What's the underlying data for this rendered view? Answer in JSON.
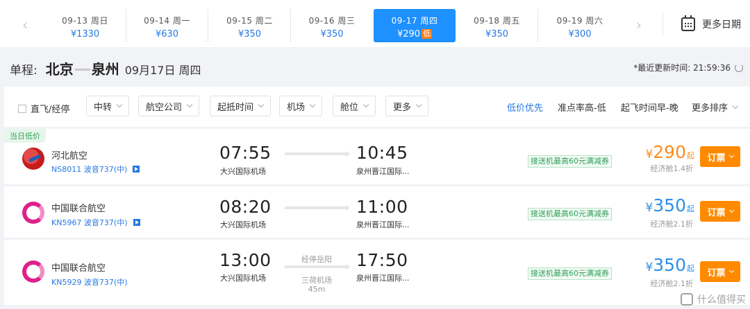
{
  "date_bar": {
    "prev_label": "‹",
    "next_label": "›",
    "dates": [
      {
        "day": "09-13  周日",
        "price": "¥1330"
      },
      {
        "day": "09-14  周一",
        "price": "¥630"
      },
      {
        "day": "09-15  周二",
        "price": "¥350"
      },
      {
        "day": "09-16  周三",
        "price": "¥350"
      },
      {
        "day": "09-17  周四",
        "price": "¥290",
        "tag": "低"
      },
      {
        "day": "09-18  周五",
        "price": "¥350"
      },
      {
        "day": "09-19  周六",
        "price": "¥300"
      }
    ],
    "more_dates": "更多日期"
  },
  "route": {
    "label": "单程:",
    "from": "北京",
    "to": "泉州",
    "date": "09月17日 周四",
    "update_text": "*最近更新时间: 21:59:36"
  },
  "filters": {
    "direct": "直飞/经停",
    "transfer": "中转",
    "airline": "航空公司",
    "time": "起抵时间",
    "airport": "机场",
    "cabin": "舱位",
    "more": "更多",
    "sort_low": "低价优先",
    "sort_punctual": "准点率高-低",
    "sort_depart": "起飞时间早-晚",
    "sort_more": "更多排序"
  },
  "flights": [
    {
      "badge": "当日低价",
      "airline": "河北航空",
      "flight_no": "NS8011 波音737(中)",
      "dep_time": "07:55",
      "dep_airport": "大兴国际机场",
      "arr_time": "10:45",
      "arr_airport": "泉州晋江国际...",
      "promo": "接送机最高60元满减券",
      "yen": "¥",
      "price": "290",
      "qi": "起",
      "cabin": "经济舱1.4折",
      "book": "订票"
    },
    {
      "airline": "中国联合航空",
      "flight_no": "KN5967 波音737(中)",
      "dep_time": "08:20",
      "dep_airport": "大兴国际机场",
      "arr_time": "11:00",
      "arr_airport": "泉州晋江国际...",
      "promo": "接送机最高60元满减券",
      "yen": "¥",
      "price": "350",
      "qi": "起",
      "cabin": "经济舱2.1折",
      "book": "订票"
    },
    {
      "airline": "中国联合航空",
      "flight_no": "KN5929 波音737(中)",
      "dep_time": "13:00",
      "dep_airport": "大兴国际机场",
      "stop_label": "经停岳阳",
      "stop_airport": "三荷机场",
      "stop_duration": "45m",
      "arr_time": "17:50",
      "arr_airport": "泉州晋江国际...",
      "promo": "接送机最高60元满减券",
      "yen": "¥",
      "price": "350",
      "qi": "起",
      "cabin": "经济舱2.1折",
      "book": "订票"
    }
  ],
  "watermark": "什么值得买",
  "colors": {
    "accent": "#1e90ff",
    "price_low": "#ff8a1c",
    "price": "#2d8fe8",
    "book": "#ff8a00"
  }
}
